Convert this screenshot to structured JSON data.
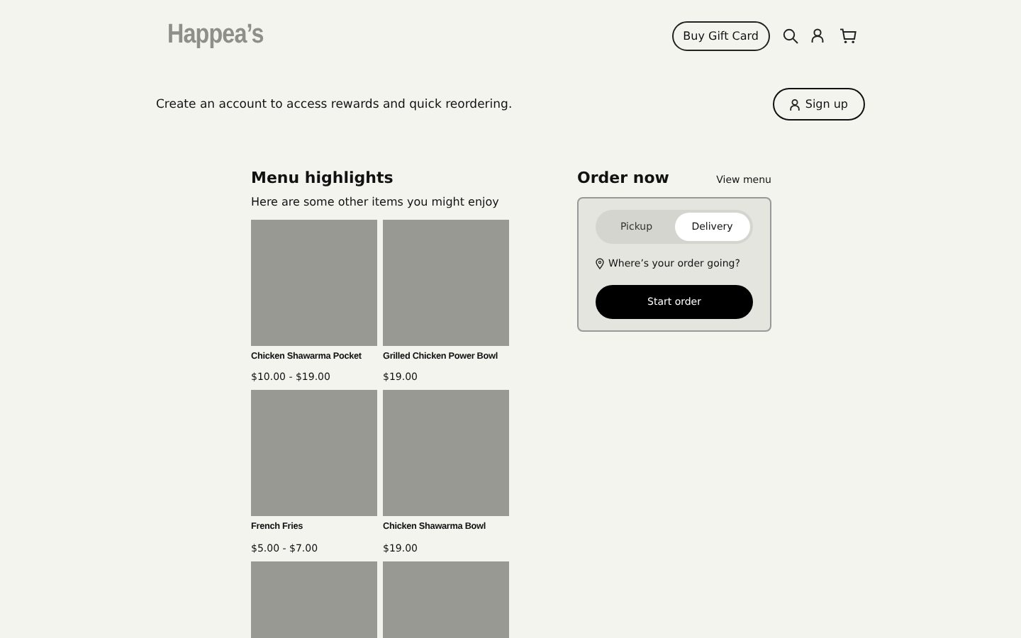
{
  "header": {
    "logo": "Happea’s",
    "gift_card_button": "Buy Gift Card"
  },
  "banner": {
    "text": "Create an account to access rewards and quick reordering.",
    "button": "Sign up"
  },
  "menu_highlights": {
    "title": "Menu highlights",
    "subtitle": "Here are some other items you might enjoy",
    "items": [
      {
        "kind": "item",
        "name": "Chicken Shawarma Pocket",
        "price": "$10.00 - $19.00"
      },
      {
        "kind": "item",
        "name": "Grilled Chicken Power Bowl",
        "price": "$19.00"
      },
      {
        "kind": "item",
        "name": "French Fries",
        "price": "$5.00 - $7.00"
      },
      {
        "kind": "item",
        "name": "Chicken Shawarma Bowl",
        "price": "$19.00"
      },
      {
        "kind": "image_only"
      },
      {
        "kind": "image_only"
      }
    ]
  },
  "order": {
    "title": "Order now",
    "link": "View menu",
    "modes": [
      {
        "label": "Pickup",
        "selected": false
      },
      {
        "label": "Delivery",
        "selected": true
      }
    ],
    "location_prompt": "Where’s your order going?",
    "button": "Start order"
  }
}
